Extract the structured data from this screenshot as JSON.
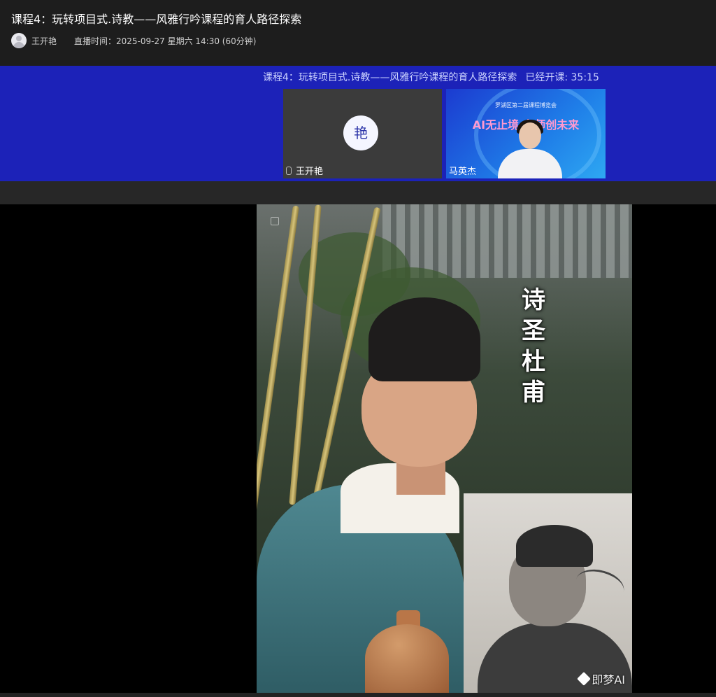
{
  "header": {
    "title": "课程4：玩转项目式.诗教——风雅行吟课程的育人路径探索",
    "host_name": "王开艳",
    "schedule": "直播时间：2025-09-27 星期六 14:30 (60分钟)"
  },
  "banner": {
    "title": "课程4：玩转项目式.诗教——风雅行吟课程的育人路径探索",
    "elapsed": "已经开课: 35:15"
  },
  "participants": [
    {
      "name": "王开艳",
      "avatar_char": "艳",
      "camera_on": false
    },
    {
      "name": "马英杰",
      "camera_on": true,
      "event_text": "罗湖区第二届课程博览会",
      "slogan": "AI无止境·名师创未来"
    }
  ],
  "video": {
    "caption": "诗圣杜甫",
    "watermark": "即梦AI"
  },
  "colors": {
    "banner_blue": "#1c22b8",
    "header_bg": "#1d1d1d",
    "stage_bg": "#000000"
  }
}
